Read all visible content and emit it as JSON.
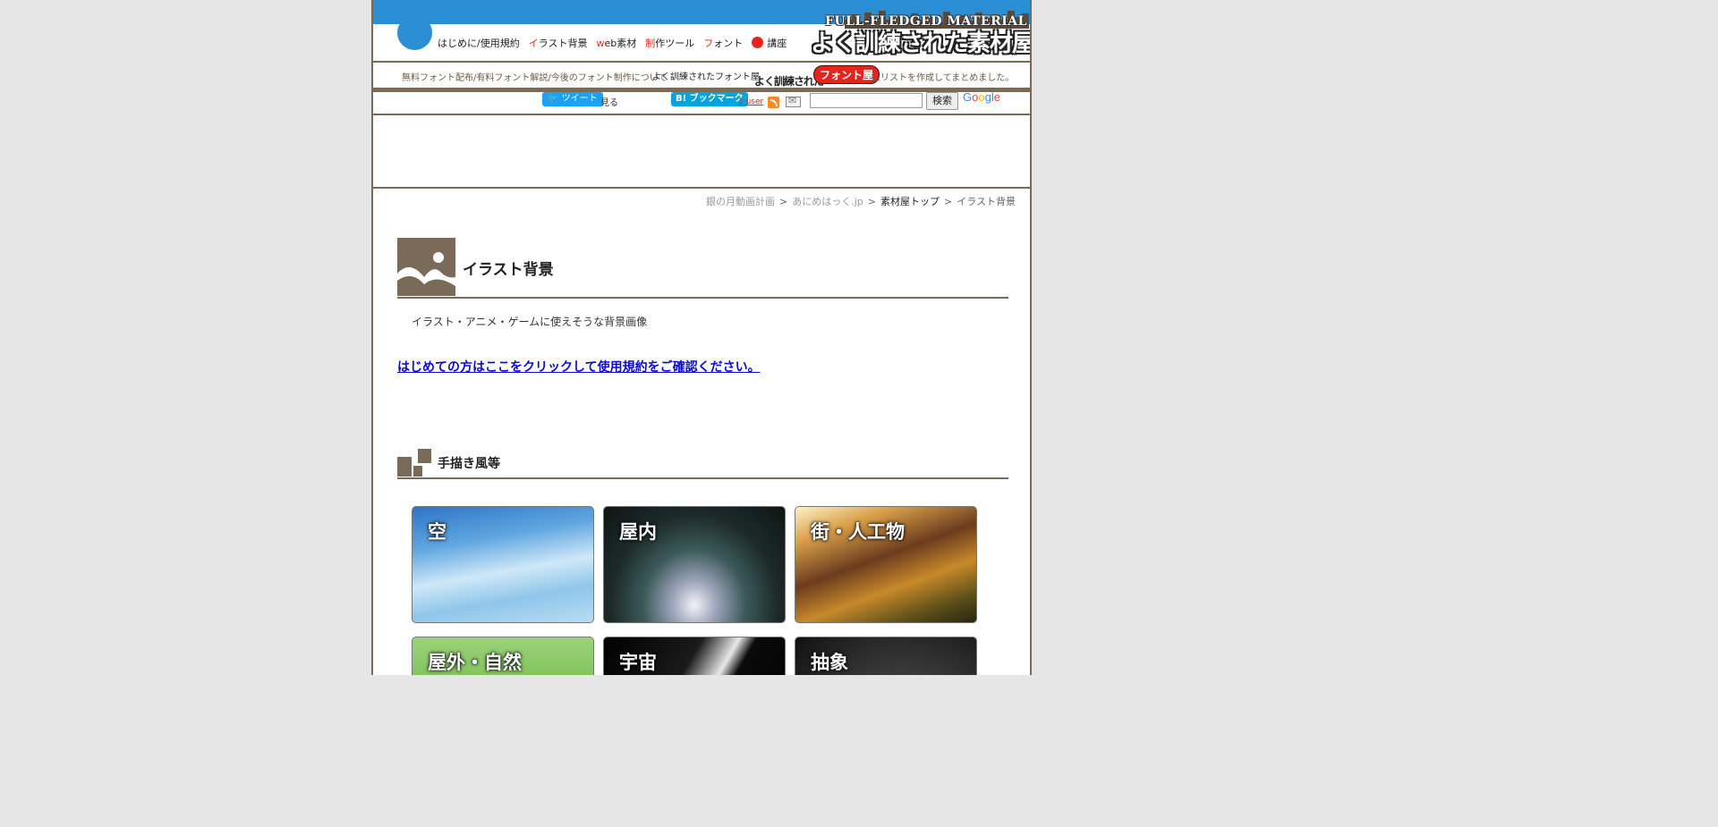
{
  "header": {
    "nav": [
      {
        "label": "はじめに/使用規約",
        "accent": ""
      },
      {
        "label": "ラスト背景",
        "accent": "イ"
      },
      {
        "label": "eb素材",
        "accent": "w"
      },
      {
        "label": "作ツール",
        "accent": "制"
      },
      {
        "label": "ォント",
        "accent": "フ"
      },
      {
        "label": "講座",
        "accent": ""
      }
    ],
    "logo_top": "FULL-FLEDGED MATERIAL",
    "logo_main": "よく訓練された素材屋"
  },
  "infobar": {
    "text_left": "無料フォント配布/有料フォント解説/今後のフォント制作について",
    "text_mid": "よく訓練されたフォント屋",
    "logo_left": "よく訓練された",
    "logo_right": "フォント屋",
    "text_right": "にリストを作成してまとめました。"
  },
  "social": {
    "tweet": "ツイート",
    "see": "見る",
    "bookmark": "B! ブックマーク",
    "users": "1 user",
    "search_button": "検索",
    "search_value": "",
    "google": "Google"
  },
  "breadcrumb": {
    "items": [
      "銀の月動画計画",
      "あにめはっく.jp",
      "素材屋トップ",
      "イラスト背景"
    ],
    "separator": ">"
  },
  "main": {
    "title": "イラスト背景",
    "description": "イラスト・アニメ・ゲームに使えそうな背景画像",
    "terms_link": "はじめての方はここをクリックして使用規約をご確認ください。"
  },
  "section": {
    "title": "手描き風等",
    "cards": [
      {
        "label": "空"
      },
      {
        "label": "屋内"
      },
      {
        "label": "街・人工物"
      },
      {
        "label": "屋外・自然"
      },
      {
        "label": "宇宙"
      },
      {
        "label": "抽象"
      }
    ]
  },
  "colors": {
    "brand_blue": "#2a8ed4",
    "brown": "#7a6a58",
    "accent_red": "#e4251b",
    "link_blue": "#0a0ad0"
  }
}
